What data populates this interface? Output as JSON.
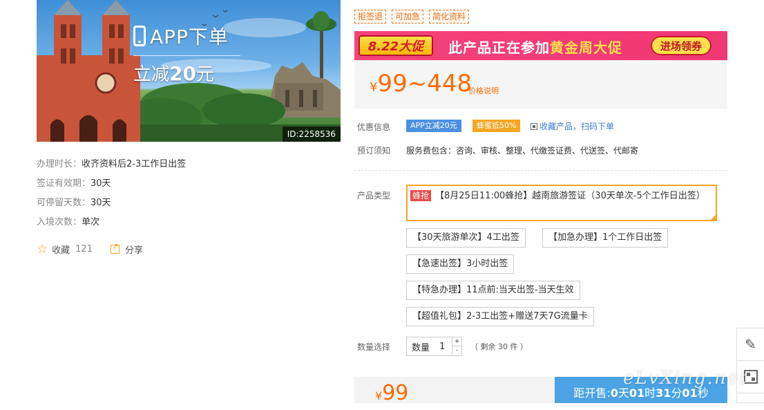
{
  "hero": {
    "app_label": "APP下单",
    "discount_prefix": "立减",
    "discount_amount": "20",
    "discount_suffix": "元",
    "product_id": "ID:2258536"
  },
  "info": [
    {
      "label": "办理时长：",
      "value": "收齐资料后2-3工作日出签"
    },
    {
      "label": "签证有效期：",
      "value": "30天"
    },
    {
      "label": "可停留天数：",
      "value": "30天"
    },
    {
      "label": "入境次数：",
      "value": "单次"
    }
  ],
  "actions": {
    "favorite_label": "收藏",
    "favorite_count": "121",
    "share_label": "分享"
  },
  "tags": [
    "拒签退",
    "可加急",
    "简化资料"
  ],
  "banner": {
    "badge": "8.22大促",
    "text_before": "此产品正在参加",
    "text_highlight": "黄金周大促",
    "button": "进场领券"
  },
  "price": {
    "currency": "¥",
    "range": "99~448",
    "explain": "价格说明"
  },
  "discount": {
    "label": "优惠信息",
    "app_pill": "APP立减20元",
    "bee_pill": "蜂蜜抵50%",
    "fav_scan": "收藏产品，扫码下单"
  },
  "notice": {
    "label": "预订须知",
    "value": "服务费包含：咨询、审核、整理、代缴签证费、代送签、代邮寄"
  },
  "product_type": {
    "label": "产品类型",
    "selected_tag": "蜂抢",
    "selected_text": "【8月25日11:00蜂抢】越南旅游签证（30天单次-5个工作日出签）",
    "options": [
      "【30天旅游单次】4工出签",
      "【加急办理】1个工作日出签",
      "【急速出签】3小时出签",
      "【特急办理】11点前:当天出签-当天生效",
      "【超值礼包】2-3工出签+赠送7天7G流量卡"
    ]
  },
  "quantity": {
    "label": "数量选择",
    "box_label": "数量",
    "value": "1",
    "plus": "+",
    "minus": "-",
    "remaining": "（ 剩余 30 件 ）"
  },
  "bottom": {
    "currency": "¥",
    "price": "99",
    "countdown_prefix": "距开售:",
    "days": "0",
    "days_unit": "天",
    "hours": "01",
    "hours_unit": "时",
    "minutes": "31",
    "minutes_unit": "分",
    "seconds": "01",
    "seconds_unit": "秒"
  },
  "watermark": "eLvXing.net",
  "colors": {
    "accent_orange": "#ff6a00",
    "banner_pink": "#f23a78",
    "countdown_blue": "#4ba3e3",
    "select_border": "#f5a623"
  }
}
